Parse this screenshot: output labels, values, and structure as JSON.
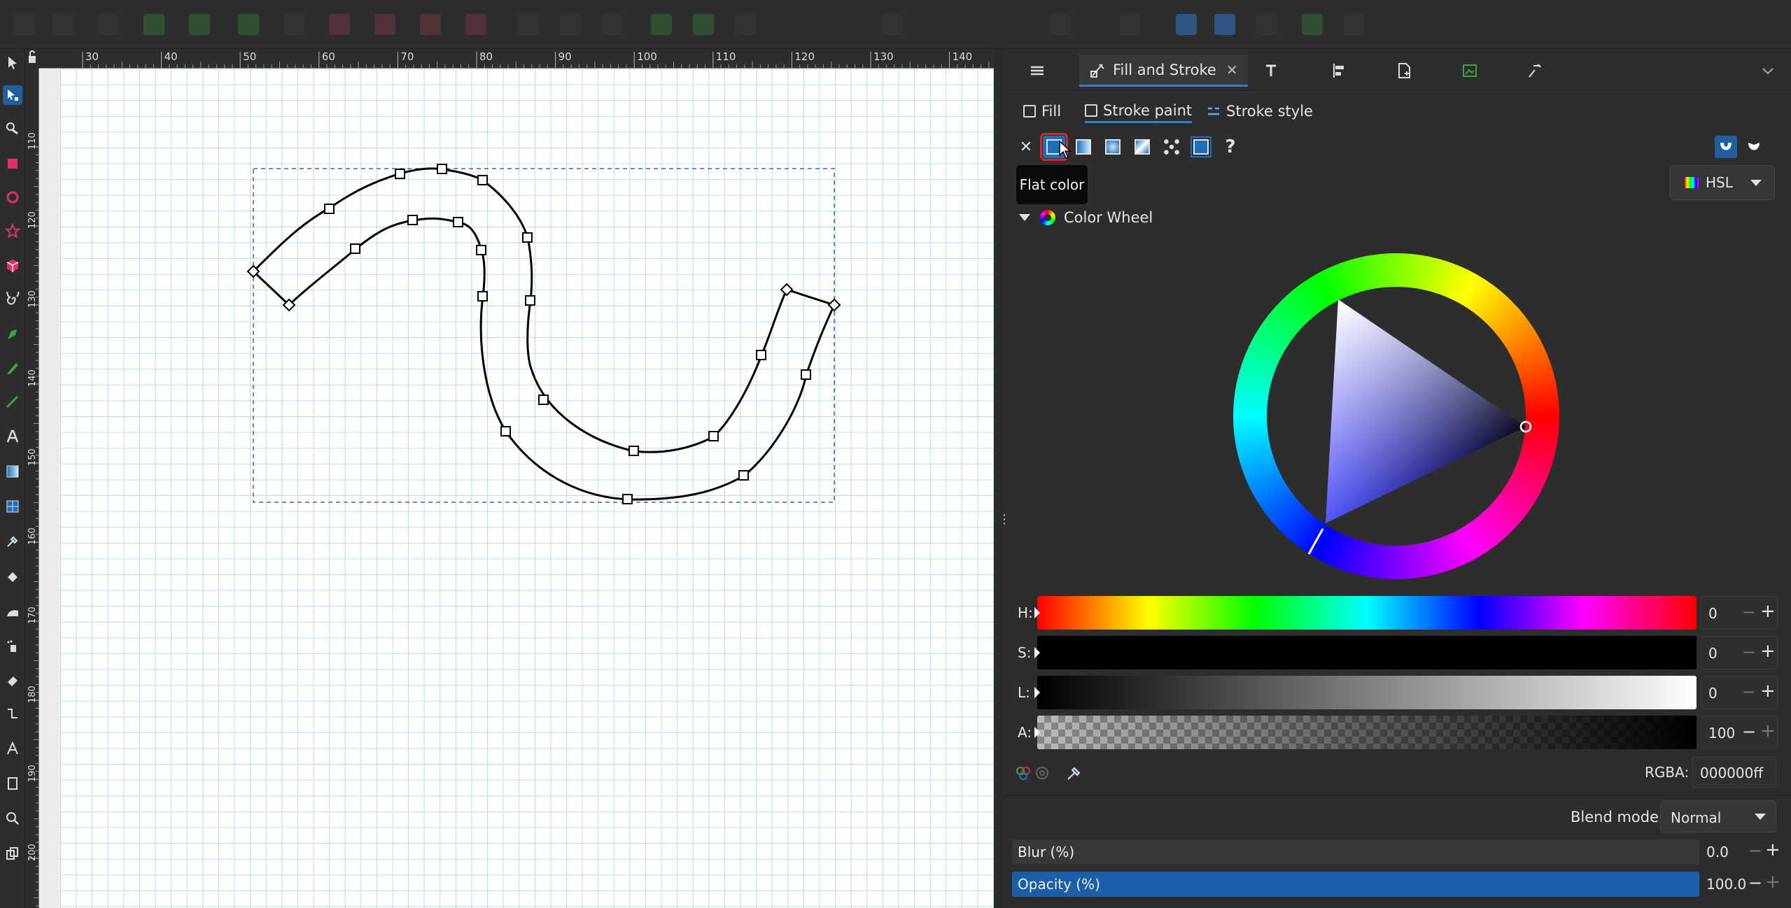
{
  "ruler": {
    "top_ticks": [
      "30",
      "40",
      "50",
      "60",
      "70",
      "80",
      "90",
      "100",
      "110",
      "120",
      "130",
      "140"
    ],
    "left_ticks": [
      "110",
      "120",
      "130",
      "140",
      "150",
      "160",
      "170",
      "180",
      "190",
      "200"
    ]
  },
  "dock": {
    "active_tab_label": "Fill and Stroke",
    "close_glyph": "✕",
    "subtabs": {
      "fill": "Fill",
      "stroke_paint": "Stroke paint",
      "stroke_style": "Stroke style"
    },
    "paint_none_glyph": "✕",
    "paint_unknown_glyph": "?",
    "tooltip": "Flat color",
    "color_mode": "HSL",
    "color_wheel_label": "Color Wheel"
  },
  "sliders": [
    {
      "label": "H:",
      "value": "0"
    },
    {
      "label": "S:",
      "value": "0"
    },
    {
      "label": "L:",
      "value": "0"
    },
    {
      "label": "A:",
      "value": "100"
    }
  ],
  "rgba": {
    "label": "RGBA:",
    "value": "000000ff"
  },
  "blend": {
    "label": "Blend mode:",
    "value": "Normal"
  },
  "blur": {
    "label": "Blur (%)",
    "value": "0.0"
  },
  "opacity": {
    "label": "Opacity (%)",
    "value": "100.0"
  },
  "colors": {
    "accent": "#1a5fa8",
    "highlight_red": "#d8262c",
    "grid": "#b8dcef",
    "stroke": "#000000"
  }
}
